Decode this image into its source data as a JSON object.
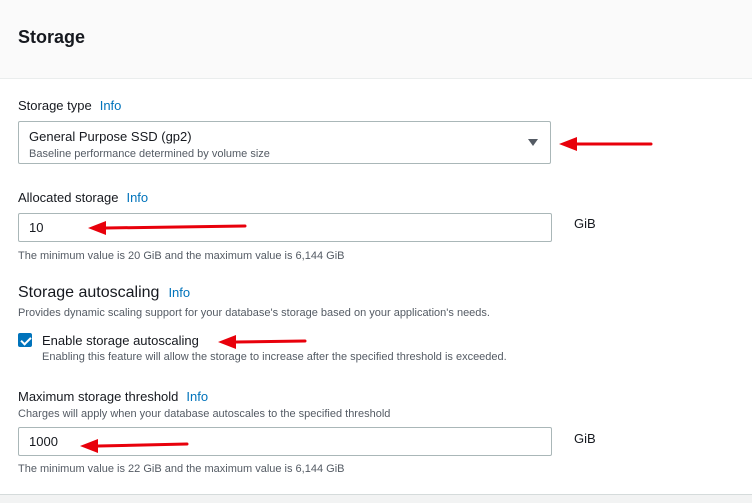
{
  "panel": {
    "title": "Storage"
  },
  "storage_type": {
    "label": "Storage type",
    "info": "Info",
    "selected": "General Purpose SSD (gp2)",
    "selected_desc": "Baseline performance determined by volume size"
  },
  "allocated": {
    "label": "Allocated storage",
    "info": "Info",
    "value": "10",
    "unit": "GiB",
    "constraint": "The minimum value is 20 GiB and the maximum value is 6,144 GiB"
  },
  "autoscaling": {
    "title": "Storage autoscaling",
    "info": "Info",
    "desc": "Provides dynamic scaling support for your database's storage based on your application's needs.",
    "checkbox_label": "Enable storage autoscaling",
    "checkbox_checked": true,
    "checkbox_desc": "Enabling this feature will allow the storage to increase after the specified threshold is exceeded."
  },
  "threshold": {
    "label": "Maximum storage threshold",
    "info": "Info",
    "desc": "Charges will apply when your database autoscales to the specified threshold",
    "value": "1000",
    "unit": "GiB",
    "constraint": "The minimum value is 22 GiB and the maximum value is 6,144 GiB"
  },
  "annotation_color": "#e8000b",
  "accent_color": "#0073bb"
}
